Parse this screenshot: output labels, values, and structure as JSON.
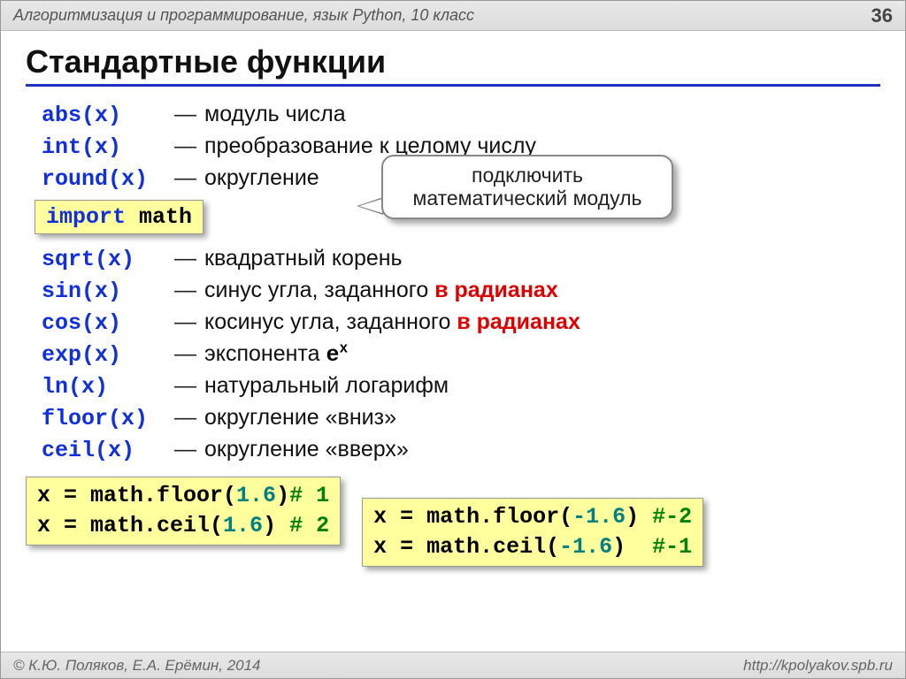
{
  "header": {
    "course": "Алгоритмизация и программирование, язык Python, 10 класс",
    "page": "36"
  },
  "title": "Стандартные функции",
  "builtins": [
    {
      "fn": "abs",
      "arg": "(x)",
      "desc": "модуль числа"
    },
    {
      "fn": "int",
      "arg": "(x)",
      "desc": "преобразование к целому числу"
    },
    {
      "fn": "round",
      "arg": "(x)",
      "desc": "округление"
    }
  ],
  "import_stmt": {
    "kw": "import",
    "mod": "math"
  },
  "callout": "подключить математический модуль",
  "mathfns": [
    {
      "fn": "sqrt",
      "arg": "(x)",
      "desc_plain": "квадратный корень"
    },
    {
      "fn": "sin",
      "arg": "(x)",
      "desc_prefix": "синус угла, заданного ",
      "desc_em": "в радианах"
    },
    {
      "fn": "cos",
      "arg": "(x)",
      "desc_prefix": "косинус угла, заданного ",
      "desc_em": "в радианах"
    },
    {
      "fn": "exp",
      "arg": "(x)",
      "desc_prefix": "экспонента ",
      "mono_tail": "e",
      "sup": "x"
    },
    {
      "fn": "ln",
      "arg": "(x)",
      "desc_plain": "натуральный логарифм"
    },
    {
      "fn": "floor",
      "arg": "(x)",
      "desc_plain": "округление «вниз»"
    },
    {
      "fn": "ceil",
      "arg": "(x)",
      "desc_plain": "округление «вверх»"
    }
  ],
  "ex_left": {
    "l1": {
      "lhs": "x = math.floor(",
      "num": "1.6",
      "rhs": ")",
      "cmt": "# 1"
    },
    "l2": {
      "lhs": "x = math.ceil(",
      "num": "1.6",
      "rhs": ") ",
      "cmt": "# 2"
    }
  },
  "ex_right": {
    "l1": {
      "lhs": "x = math.floor(",
      "num": "-1.6",
      "rhs": ") ",
      "cmt": "#-2"
    },
    "l2": {
      "lhs": "x = math.ceil(",
      "num": "-1.6",
      "rhs": ")  ",
      "cmt": "#-1"
    }
  },
  "footer": {
    "left": "© К.Ю. Поляков, Е.А. Ерёмин, 2014",
    "right": "http://kpolyakov.spb.ru"
  },
  "dash": "—"
}
